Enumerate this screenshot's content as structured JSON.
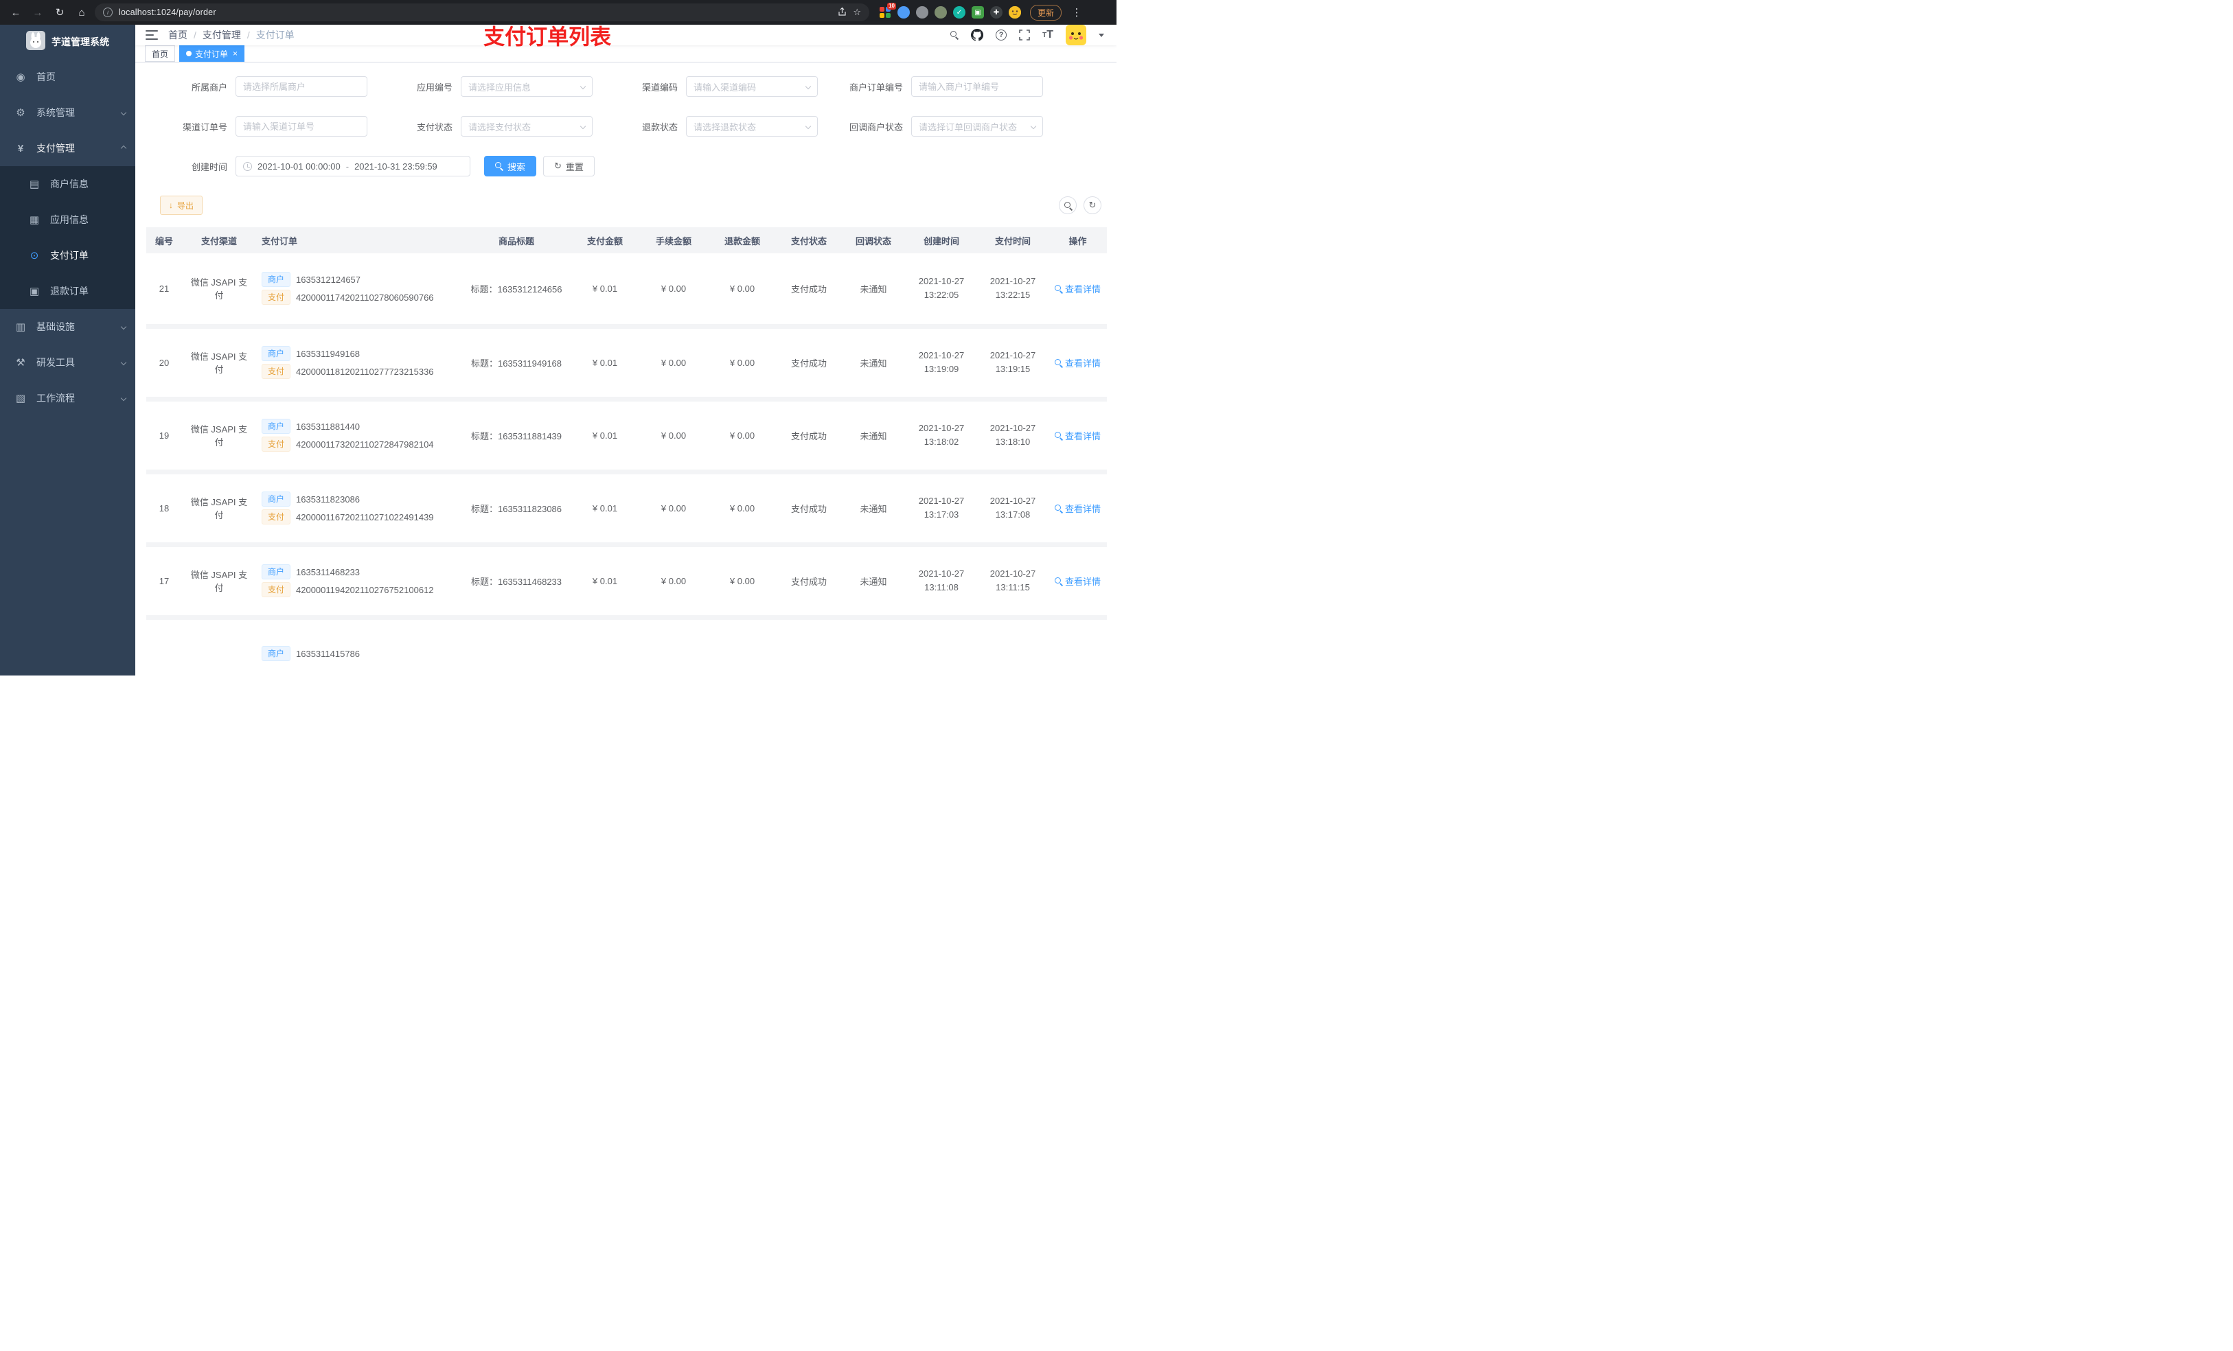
{
  "browser": {
    "url": "localhost:1024/pay/order",
    "update_label": "更新",
    "extension_badge": "10"
  },
  "icons": {
    "back": "←",
    "forward": "→",
    "reload": "↻",
    "home": "⌂",
    "info": "i",
    "star": "☆",
    "dots": "⋮",
    "question": "?",
    "font_small": "T",
    "font_big": "T",
    "check": "✓",
    "download": "↓",
    "refresh": "↻",
    "close": "×"
  },
  "sidebar": {
    "logo_title": "芋道管理系统",
    "menu": [
      {
        "label": "首页",
        "glyph": "◉"
      },
      {
        "label": "系统管理",
        "glyph": "⚙"
      },
      {
        "label": "支付管理",
        "glyph": "¥"
      },
      {
        "label": "基础设施",
        "glyph": "▥"
      },
      {
        "label": "研发工具",
        "glyph": "⚒"
      },
      {
        "label": "工作流程",
        "glyph": "▧"
      }
    ],
    "submenu": [
      {
        "label": "商户信息",
        "glyph": "▤"
      },
      {
        "label": "应用信息",
        "glyph": "▦"
      },
      {
        "label": "支付订单",
        "glyph": "⊙"
      },
      {
        "label": "退款订单",
        "glyph": "▣"
      }
    ]
  },
  "navbar": {
    "breadcrumb": [
      "首页",
      "支付管理",
      "支付订单"
    ],
    "separator": "/",
    "annotation": "支付订单列表"
  },
  "tabs": [
    {
      "label": "首页"
    },
    {
      "label": "支付订单"
    }
  ],
  "filters": {
    "row1": [
      {
        "label": "所属商户",
        "placeholder": "请选择所属商户",
        "type": "input"
      },
      {
        "label": "应用编号",
        "placeholder": "请选择应用信息",
        "type": "select"
      },
      {
        "label": "渠道编码",
        "placeholder": "请输入渠道编码",
        "type": "select"
      },
      {
        "label": "商户订单编号",
        "placeholder": "请输入商户订单编号",
        "type": "input"
      }
    ],
    "row2": [
      {
        "label": "渠道订单号",
        "placeholder": "请输入渠道订单号",
        "type": "input"
      },
      {
        "label": "支付状态",
        "placeholder": "请选择支付状态",
        "type": "select"
      },
      {
        "label": "退款状态",
        "placeholder": "请选择退款状态",
        "type": "select"
      },
      {
        "label": "回调商户状态",
        "placeholder": "请选择订单回调商户状态",
        "type": "select"
      }
    ],
    "date": {
      "label": "创建时间",
      "start": "2021-10-01 00:00:00",
      "separator": "-",
      "end": "2021-10-31 23:59:59"
    },
    "search_label": "搜索",
    "reset_label": "重置"
  },
  "toolbar": {
    "export_label": "导出"
  },
  "table": {
    "columns": [
      "编号",
      "支付渠道",
      "支付订单",
      "商品标题",
      "支付金额",
      "手续金额",
      "退款金额",
      "支付状态",
      "回调状态",
      "创建时间",
      "支付时间",
      "操作"
    ],
    "merchant_tag": "商户",
    "pay_tag": "支付",
    "action_label": "查看详情",
    "rows": [
      {
        "id": "21",
        "channel": "微信 JSAPI 支付",
        "merchant_no": "1635312124657",
        "pay_no": "4200001174202110278060590766",
        "title": "标题：1635312124656",
        "pay_amount": "¥ 0.01",
        "fee_amount": "¥ 0.00",
        "refund_amount": "¥ 0.00",
        "pay_status": "支付成功",
        "notify_status": "未通知",
        "create_date": "2021-10-27",
        "create_time": "13:22:05",
        "pay_date": "2021-10-27",
        "pay_time": "13:22:15"
      },
      {
        "id": "20",
        "channel": "微信 JSAPI 支付",
        "merchant_no": "1635311949168",
        "pay_no": "4200001181202110277723215336",
        "title": "标题：1635311949168",
        "pay_amount": "¥ 0.01",
        "fee_amount": "¥ 0.00",
        "refund_amount": "¥ 0.00",
        "pay_status": "支付成功",
        "notify_status": "未通知",
        "create_date": "2021-10-27",
        "create_time": "13:19:09",
        "pay_date": "2021-10-27",
        "pay_time": "13:19:15"
      },
      {
        "id": "19",
        "channel": "微信 JSAPI 支付",
        "merchant_no": "1635311881440",
        "pay_no": "4200001173202110272847982104",
        "title": "标题：1635311881439",
        "pay_amount": "¥ 0.01",
        "fee_amount": "¥ 0.00",
        "refund_amount": "¥ 0.00",
        "pay_status": "支付成功",
        "notify_status": "未通知",
        "create_date": "2021-10-27",
        "create_time": "13:18:02",
        "pay_date": "2021-10-27",
        "pay_time": "13:18:10"
      },
      {
        "id": "18",
        "channel": "微信 JSAPI 支付",
        "merchant_no": "1635311823086",
        "pay_no": "4200001167202110271022491439",
        "title": "标题：1635311823086",
        "pay_amount": "¥ 0.01",
        "fee_amount": "¥ 0.00",
        "refund_amount": "¥ 0.00",
        "pay_status": "支付成功",
        "notify_status": "未通知",
        "create_date": "2021-10-27",
        "create_time": "13:17:03",
        "pay_date": "2021-10-27",
        "pay_time": "13:17:08"
      },
      {
        "id": "17",
        "channel": "微信 JSAPI 支付",
        "merchant_no": "1635311468233",
        "pay_no": "4200001194202110276752100612",
        "title": "标题：1635311468233",
        "pay_amount": "¥ 0.01",
        "fee_amount": "¥ 0.00",
        "refund_amount": "¥ 0.00",
        "pay_status": "支付成功",
        "notify_status": "未通知",
        "create_date": "2021-10-27",
        "create_time": "13:11:08",
        "pay_date": "2021-10-27",
        "pay_time": "13:11:15"
      }
    ],
    "partial_row": {
      "merchant_no": "1635311415786"
    }
  }
}
